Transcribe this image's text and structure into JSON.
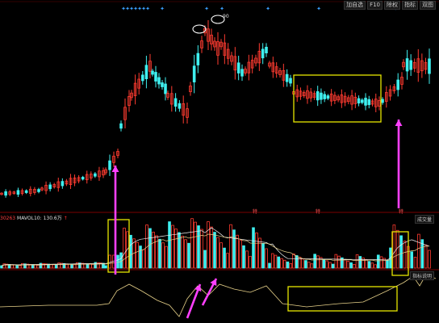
{
  "toolbar": {
    "buttons": [
      "加自选",
      "F10",
      "除权",
      "指标",
      "双图"
    ]
  },
  "volume_panel": {
    "code_fragment": "30263",
    "indicator_label": "MAVOL10:",
    "indicator_value": "130.6万",
    "marker": "↑",
    "panel_label": "成交量"
  },
  "indicator_panel": {
    "panel_label": "指标说明"
  },
  "peak_label": "90",
  "event_markers": [
    "特",
    "特",
    "特"
  ],
  "colors": {
    "up": "#ff3b30",
    "down": "#3ff0f0",
    "ma_line": "#e8d28a",
    "box": "#e6e600",
    "arrow": "#ff40ff",
    "star": "#3aa0ff"
  }
}
